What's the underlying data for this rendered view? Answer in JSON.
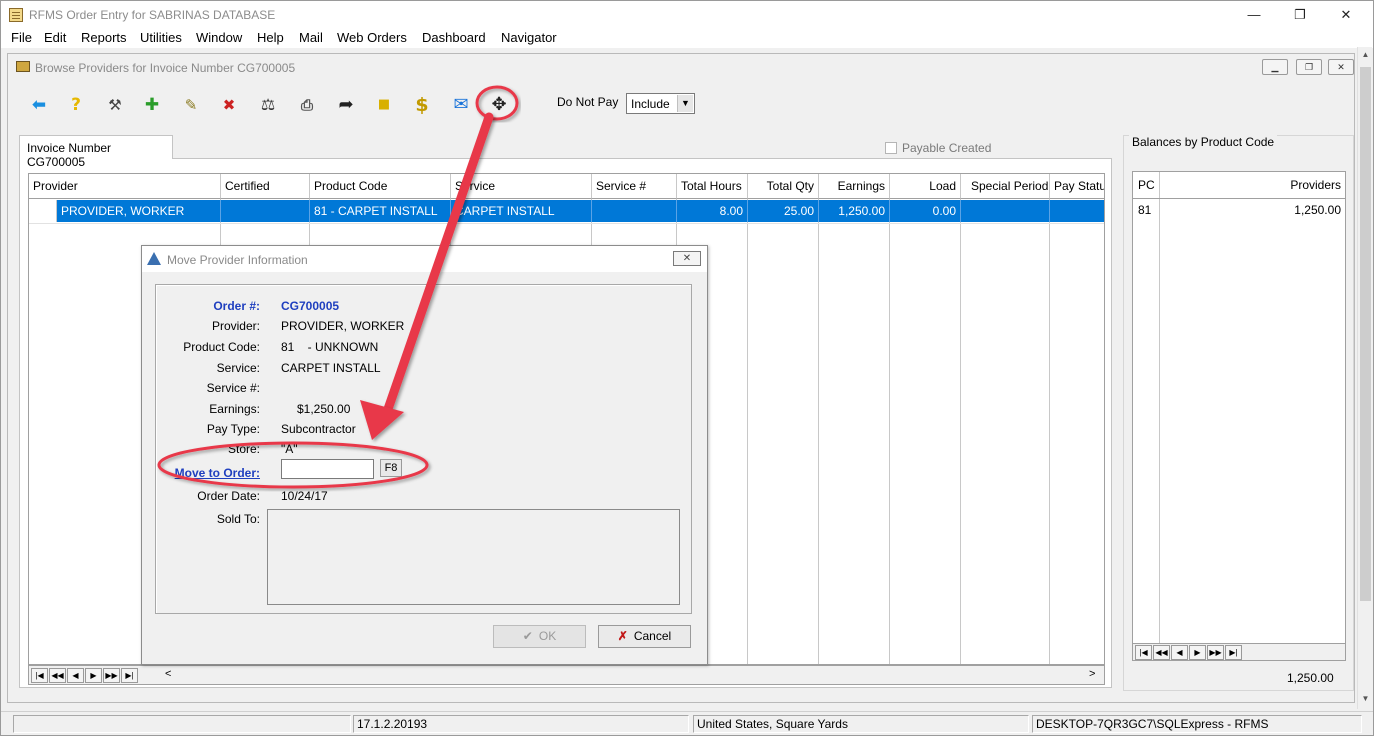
{
  "app": {
    "title": "RFMS Order Entry for SABRINAS DATABASE",
    "controls": {
      "minimize": "—",
      "restore": "❐",
      "close": "✕"
    }
  },
  "menu": [
    "File",
    "Edit",
    "Reports",
    "Utilities",
    "Window",
    "Help",
    "Mail",
    "Web Orders",
    "Dashboard",
    "Navigator"
  ],
  "browse_window": {
    "title": "Browse Providers for Invoice Number CG700005",
    "controls": {
      "minimize": "▁",
      "restore": "❐",
      "close": "✕"
    }
  },
  "toolbar": {
    "icons": [
      "back-arrow-icon",
      "help-icon",
      "tools-icon",
      "add-icon",
      "edit-document-icon",
      "delete-document-icon",
      "balance-scale-icon",
      "print-icon",
      "redo-arrow-icon",
      "note-icon",
      "dollar-icon",
      "mail-icon",
      "move-icon"
    ],
    "do_not_pay_label": "Do Not Pay",
    "do_not_pay_value": "Include"
  },
  "tab": {
    "label": "Invoice Number CG700005"
  },
  "payable_created": {
    "label": "Payable Created",
    "checked": false
  },
  "grid": {
    "columns": [
      "Provider",
      "Certified",
      "Product Code",
      "Service",
      "Service #",
      "Total Hours",
      "Total Qty",
      "Earnings",
      "Load",
      "Special Period",
      "Pay Status"
    ],
    "rows": [
      {
        "provider": "PROVIDER, WORKER",
        "certified": "",
        "product_code": "81 - CARPET INSTALL",
        "service": "CARPET INSTALL",
        "service_no": "",
        "total_hours": "8.00",
        "total_qty": "25.00",
        "earnings": "1,250.00",
        "load": "0.00",
        "special_period": "",
        "pay_status": ""
      }
    ]
  },
  "balances": {
    "title": "Balances by Product Code",
    "columns": [
      "PC",
      "Providers"
    ],
    "rows": [
      {
        "pc": "81",
        "providers": "1,250.00"
      }
    ],
    "total": "1,250.00"
  },
  "statusbar": {
    "version": "17.1.2.20193",
    "region": "United States, Square Yards",
    "server": "DESKTOP-7QR3GC7\\SQLExpress - RFMS"
  },
  "dialog": {
    "title": "Move Provider Information",
    "close": "✕",
    "fields": {
      "order_label": "Order #:",
      "order_value": "CG700005",
      "provider_label": "Provider:",
      "provider_value": "PROVIDER, WORKER",
      "product_code_label": "Product Code:",
      "product_code_value": "81    - UNKNOWN",
      "service_label": "Service:",
      "service_value": "CARPET INSTALL",
      "service_no_label": "Service #:",
      "service_no_value": "",
      "earnings_label": "Earnings:",
      "earnings_value": "$1,250.00",
      "pay_type_label": "Pay Type:",
      "pay_type_value": "Subcontractor",
      "store_label": "Store:",
      "store_value": "\"A\"",
      "move_to_order_label": "Move to Order:",
      "move_to_order_value": "",
      "f8_label": "F8",
      "order_date_label": "Order Date:",
      "order_date_value": "10/24/17",
      "sold_to_label": "Sold To:",
      "sold_to_value": ""
    },
    "ok_label": "OK",
    "cancel_label": "Cancel"
  },
  "colors": {
    "selection": "#0078d7",
    "annotation": "#e8394a",
    "blue_label": "#1f3fbf"
  }
}
